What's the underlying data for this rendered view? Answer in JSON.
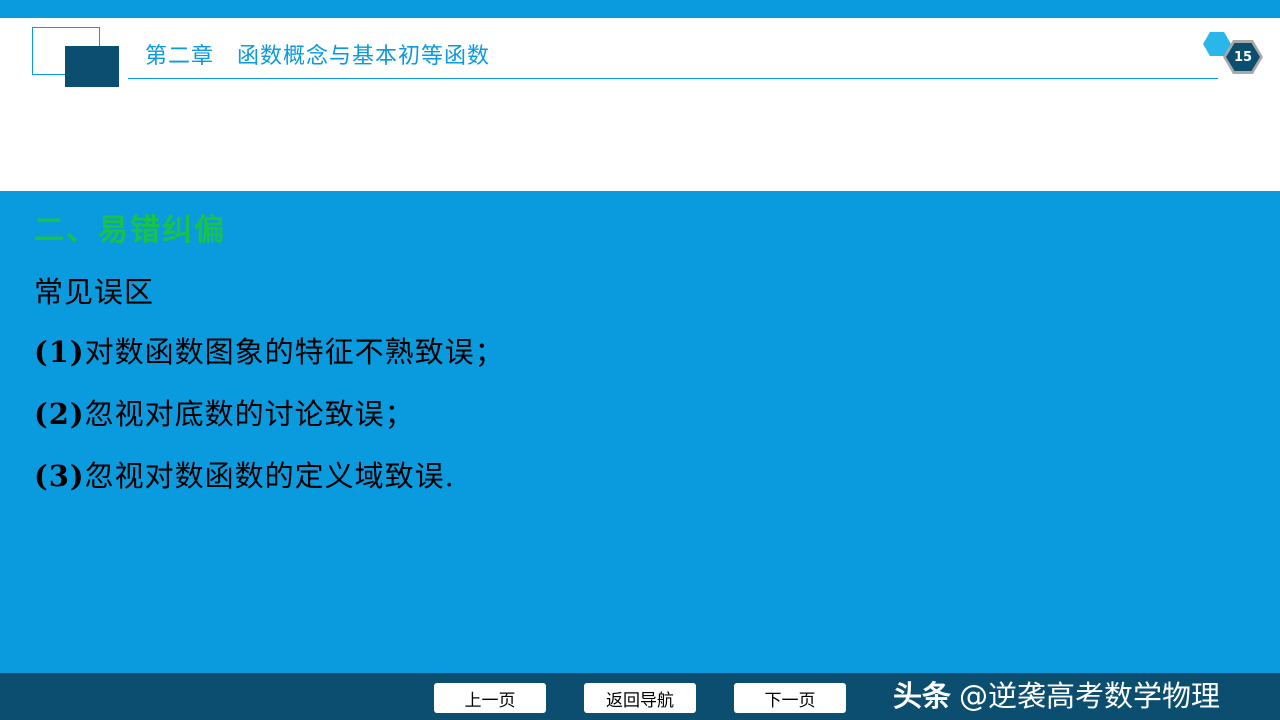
{
  "header": {
    "chapter_title": "第二章　函数概念与基本初等函数",
    "page_number": "15"
  },
  "content": {
    "section_heading": "二、易错纠偏",
    "subheading": "常见误区",
    "items": [
      {
        "num": "(1)",
        "text": "对数函数图象的特征不熟致误；"
      },
      {
        "num": "(2)",
        "text": "忽视对底数的讨论致误；"
      },
      {
        "num": "(3)",
        "text": "忽视对数函数的定义域致误."
      }
    ]
  },
  "footer": {
    "prev_label": "上一页",
    "back_label": "返回导航",
    "next_label": "下一页",
    "watermark_brand": "头条",
    "watermark_handle": "@逆袭高考数学物理"
  },
  "colors": {
    "accent_blue": "#0a9ade",
    "dark_navy": "#0b4e70",
    "heading_green": "#19c24a"
  },
  "icons": {
    "header_deco": "square-deco-icon",
    "page_badge": "hexagon-icon"
  }
}
